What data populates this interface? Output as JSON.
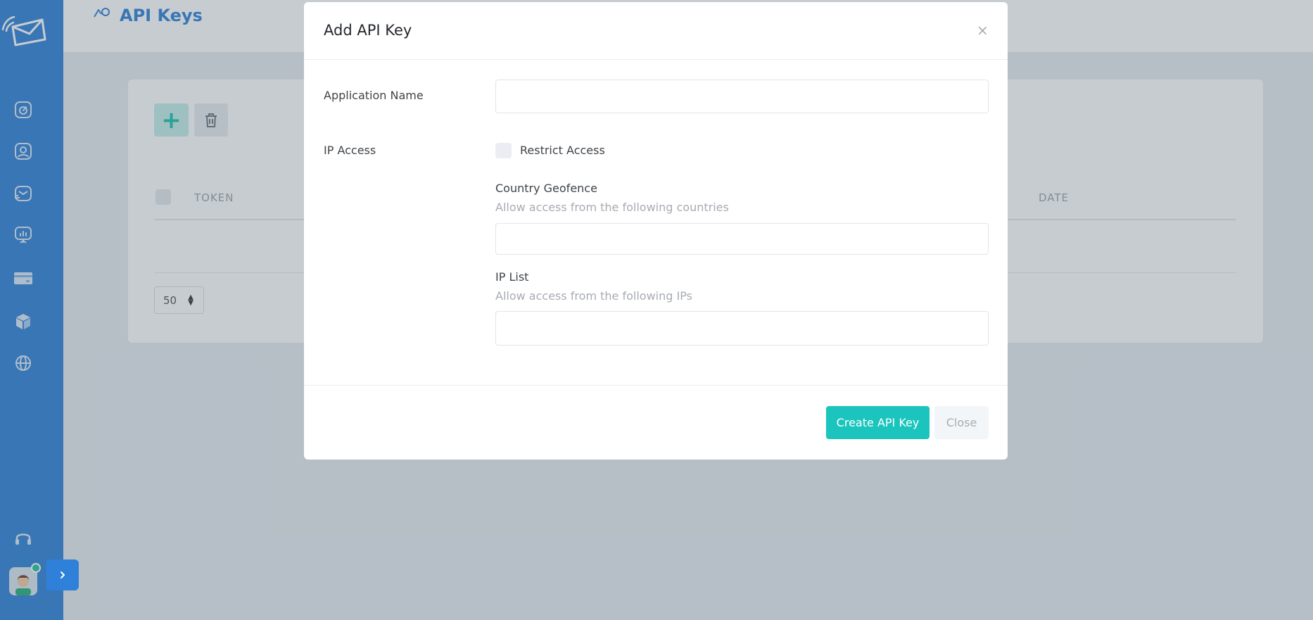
{
  "header": {
    "title": "API Keys",
    "icon": "api-keys-icon"
  },
  "sidebar": {
    "items": [
      {
        "icon": "dashboard-gauge-icon"
      },
      {
        "icon": "contacts-icon"
      },
      {
        "icon": "campaigns-mail-icon"
      },
      {
        "icon": "reports-presentation-icon"
      },
      {
        "icon": "billing-card-icon"
      },
      {
        "icon": "integrations-cube-icon"
      },
      {
        "icon": "domains-globe-icon"
      }
    ],
    "support_icon": "headset-icon"
  },
  "toolbar": {
    "add_label": "+"
  },
  "table": {
    "columns": [
      "TOKEN",
      "DATE"
    ],
    "page_size": "50"
  },
  "modal": {
    "title": "Add API Key",
    "close_symbol": "×",
    "app_name_label": "Application Name",
    "app_name_value": "",
    "ip_access_label": "IP Access",
    "restrict_label": "Restrict Access",
    "geofence_label": "Country Geofence",
    "geofence_hint": "Allow access from the following countries",
    "ip_list_label": "IP List",
    "ip_list_hint": "Allow access from the following IPs",
    "create_label": "Create API Key",
    "close_label": "Close"
  },
  "colors": {
    "brand": "#2f80d8",
    "accent": "#1bc5bd"
  }
}
